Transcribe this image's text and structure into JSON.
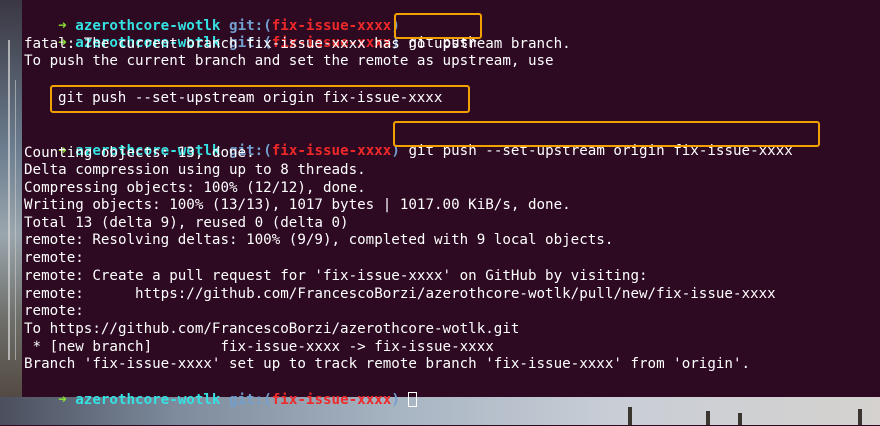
{
  "prompt": {
    "arrow": "➜",
    "dir": "azerothcore-wotlk",
    "git_label": "git:(",
    "branch": "fix-issue-xxxx",
    "close": ")"
  },
  "cmd1": "git push",
  "fatal1": "fatal: The current branch fix-issue-xxxx has no upstream branch.",
  "fatal2": "To push the current branch and set the remote as upstream, use",
  "suggested": "git push --set-upstream origin fix-issue-xxxx",
  "cmd2": "git push --set-upstream origin fix-issue-xxxx",
  "output": [
    "Counting objects: 13, done.",
    "Delta compression using up to 8 threads.",
    "Compressing objects: 100% (12/12), done.",
    "Writing objects: 100% (13/13), 1017 bytes | 1017.00 KiB/s, done.",
    "Total 13 (delta 9), reused 0 (delta 0)",
    "remote: Resolving deltas: 100% (9/9), completed with 9 local objects.",
    "remote:",
    "remote: Create a pull request for 'fix-issue-xxxx' on GitHub by visiting:",
    "remote:      https://github.com/FrancescoBorzi/azerothcore-wotlk/pull/new/fix-issue-xxxx",
    "remote:",
    "To https://github.com/FrancescoBorzi/azerothcore-wotlk.git",
    " * [new branch]        fix-issue-xxxx -> fix-issue-xxxx",
    "Branch 'fix-issue-xxxx' set up to track remote branch 'fix-issue-xxxx' from 'origin'."
  ],
  "colors": {
    "background": "#2d0922",
    "arrow": "#8ae234",
    "dir": "#34e2e2",
    "git": "#729fcf",
    "branch": "#ef2929",
    "highlight_box": "#f0a000"
  }
}
